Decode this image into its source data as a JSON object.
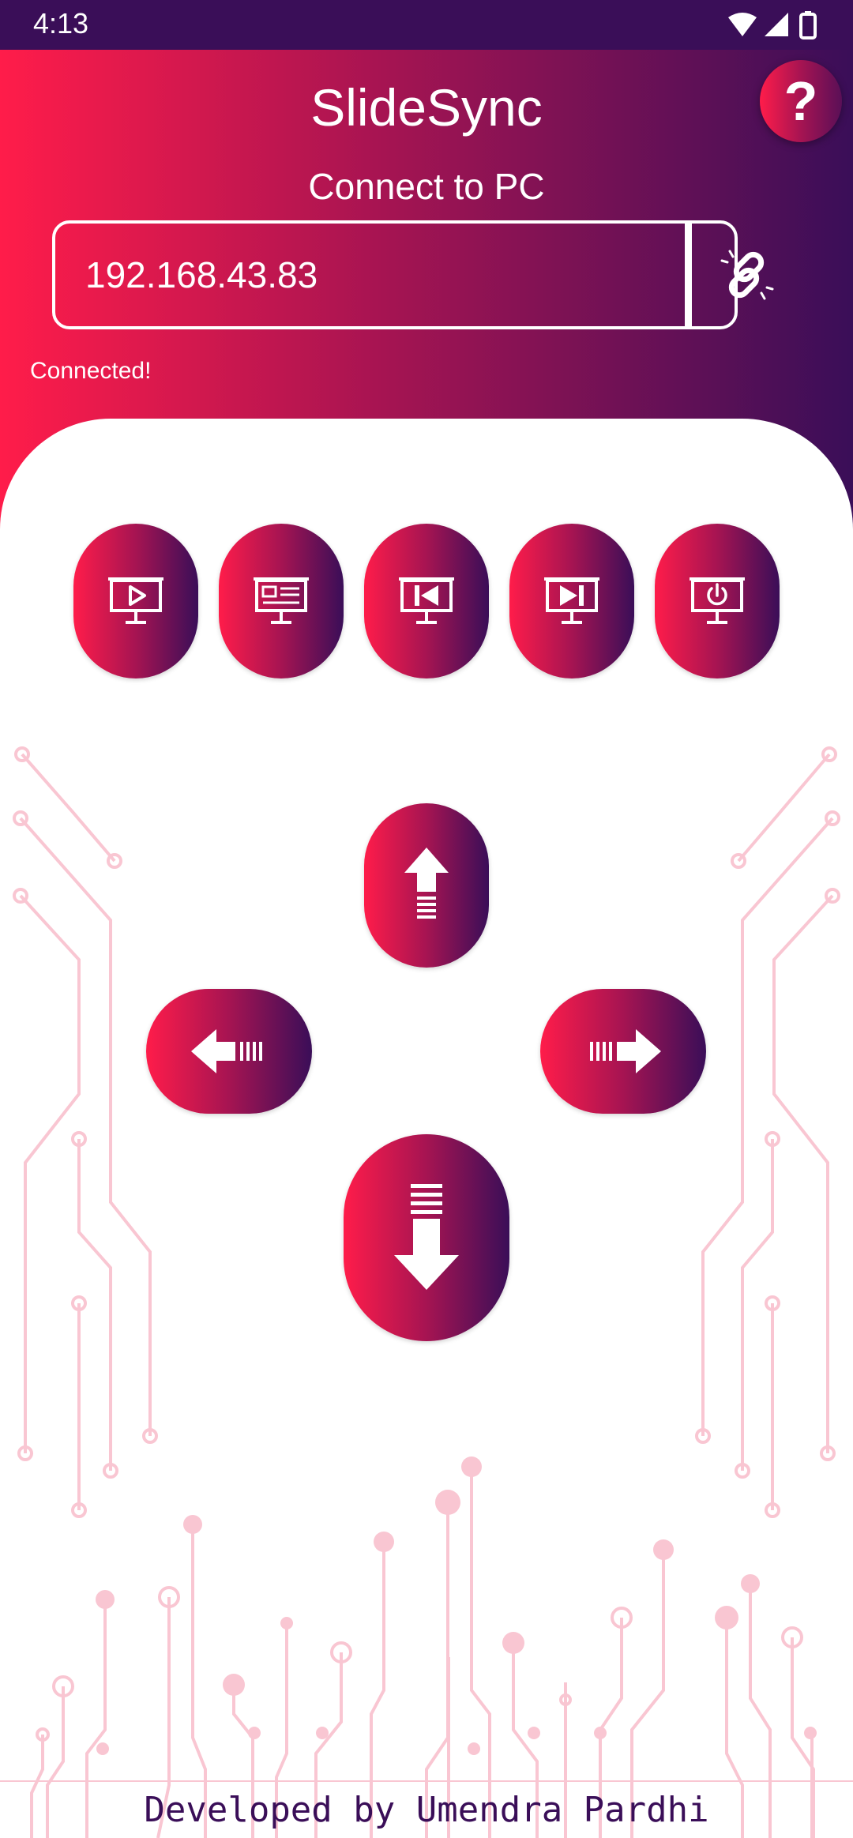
{
  "status_bar": {
    "time": "4:13",
    "icons": [
      "wifi-icon",
      "signal-icon",
      "battery-icon"
    ]
  },
  "header": {
    "title": "SlideSync",
    "help_label": "?",
    "subtitle": "Connect to PC"
  },
  "connection": {
    "ip_value": "192.168.43.83",
    "connect_icon": "link-icon",
    "status": "Connected!"
  },
  "presentation_controls": [
    {
      "name": "start-presentation-button",
      "icon": "monitor-play-icon"
    },
    {
      "name": "slide-overview-button",
      "icon": "monitor-slides-icon"
    },
    {
      "name": "first-slide-button",
      "icon": "monitor-skip-back-icon"
    },
    {
      "name": "last-slide-button",
      "icon": "monitor-skip-forward-icon"
    },
    {
      "name": "end-presentation-button",
      "icon": "monitor-power-icon"
    }
  ],
  "navigation": {
    "up_icon": "arrow-up-icon",
    "left_icon": "arrow-left-icon",
    "right_icon": "arrow-right-icon",
    "down_icon": "arrow-down-icon"
  },
  "footer": {
    "credit": "Developed by Umendra Pardhi"
  },
  "colors": {
    "gradient_start": "#ff1c4a",
    "gradient_end": "#3a0e58",
    "status_bar": "#3a0e58",
    "circuit": "#f9c6d2"
  }
}
